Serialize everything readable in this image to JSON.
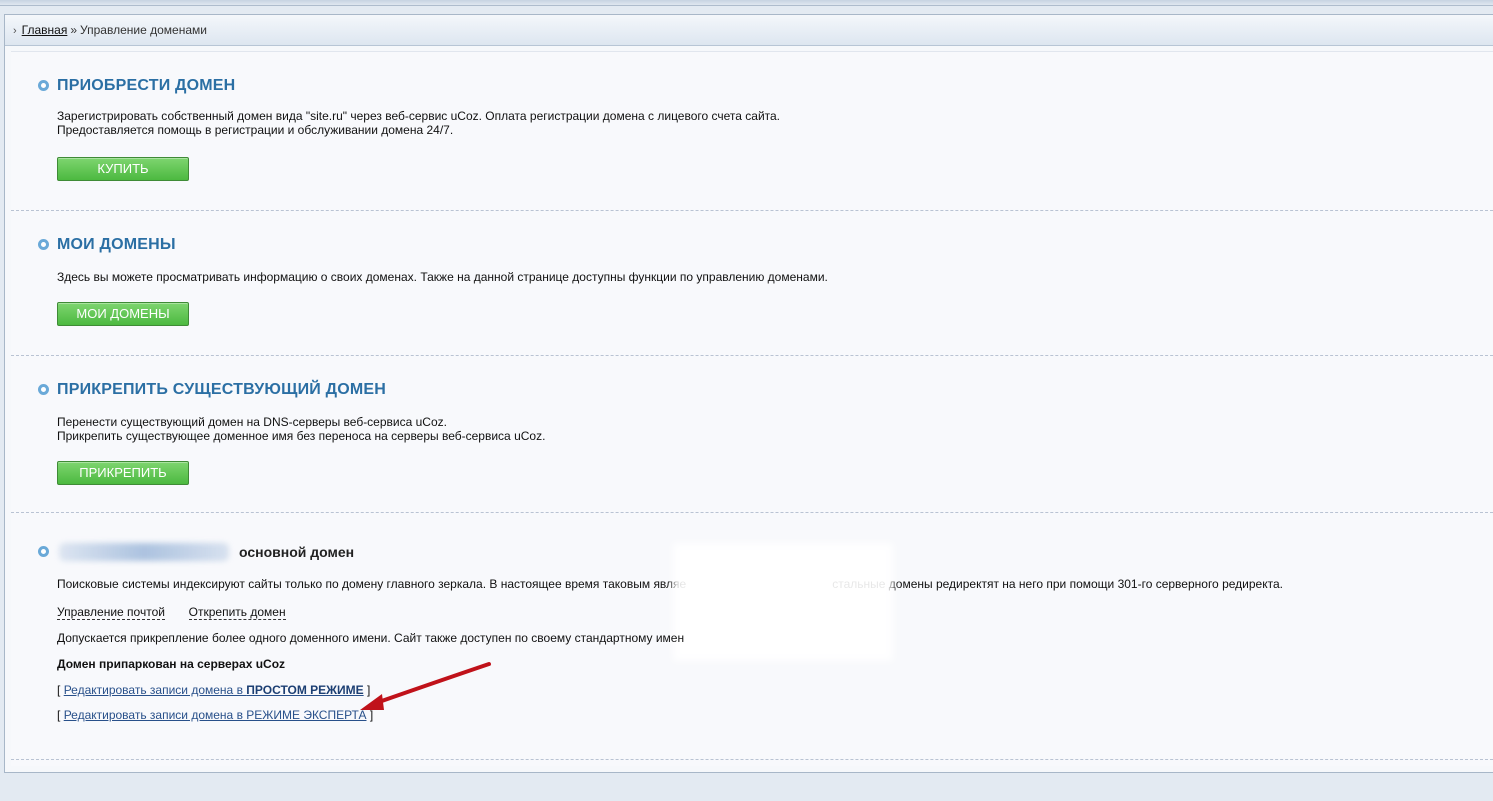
{
  "breadcrumb": {
    "home": "Главная",
    "separator": "»",
    "current": "Управление доменами"
  },
  "sections": {
    "buy": {
      "title": "ПРИОБРЕСТИ ДОМЕН",
      "line1": "Зарегистрировать собственный домен вида \"site.ru\" через веб-сервис uCoz. Оплата регистрации домена с лицевого счета сайта.",
      "line2": "Предоставляется помощь в регистрации и обслуживании домена 24/7.",
      "button": "КУПИТЬ"
    },
    "my_domains": {
      "title": "МОИ ДОМЕНЫ",
      "line1": "Здесь вы можете просматривать информацию о своих доменах. Также на данной странице доступны функции по управлению доменами.",
      "button": "МОИ ДОМЕНЫ"
    },
    "attach": {
      "title": "ПРИКРЕПИТЬ СУЩЕСТВУЮЩИЙ ДОМЕН",
      "line1": "Перенести существующий домен на DNS-серверы веб-сервиса uCoz.",
      "line2": "Прикрепить существующее доменное имя без переноса на серверы веб-сервиса uCoz.",
      "button": "ПРИКРЕПИТЬ"
    },
    "primary": {
      "label": "основной домен",
      "mirror_text": "Поисковые системы индексируют сайты только по домену главного зеркала. В настоящее время таковым являе",
      "mirror_text_tail": "стальные домены редиректят на него при помощи 301-го серверного редиректа.",
      "mail_link": "Управление почтой",
      "detach_link": "Открепить домен",
      "multi_text": "Допускается прикрепление более одного доменного имени. Сайт также доступен по своему стандартному имен",
      "parked": "Домен припаркован на серверах uCoz",
      "simple_prefix": "Редактировать записи домена в ",
      "simple_bold": "ПРОСТОМ РЕЖИМЕ",
      "expert_link": "Редактировать записи домена в РЕЖИМЕ ЭКСПЕРТА",
      "bracket_open": "[",
      "bracket_close": "]"
    }
  },
  "colors": {
    "title": "#2b6fa4",
    "button_green": "#4cb940",
    "arrow": "#c0121a"
  }
}
